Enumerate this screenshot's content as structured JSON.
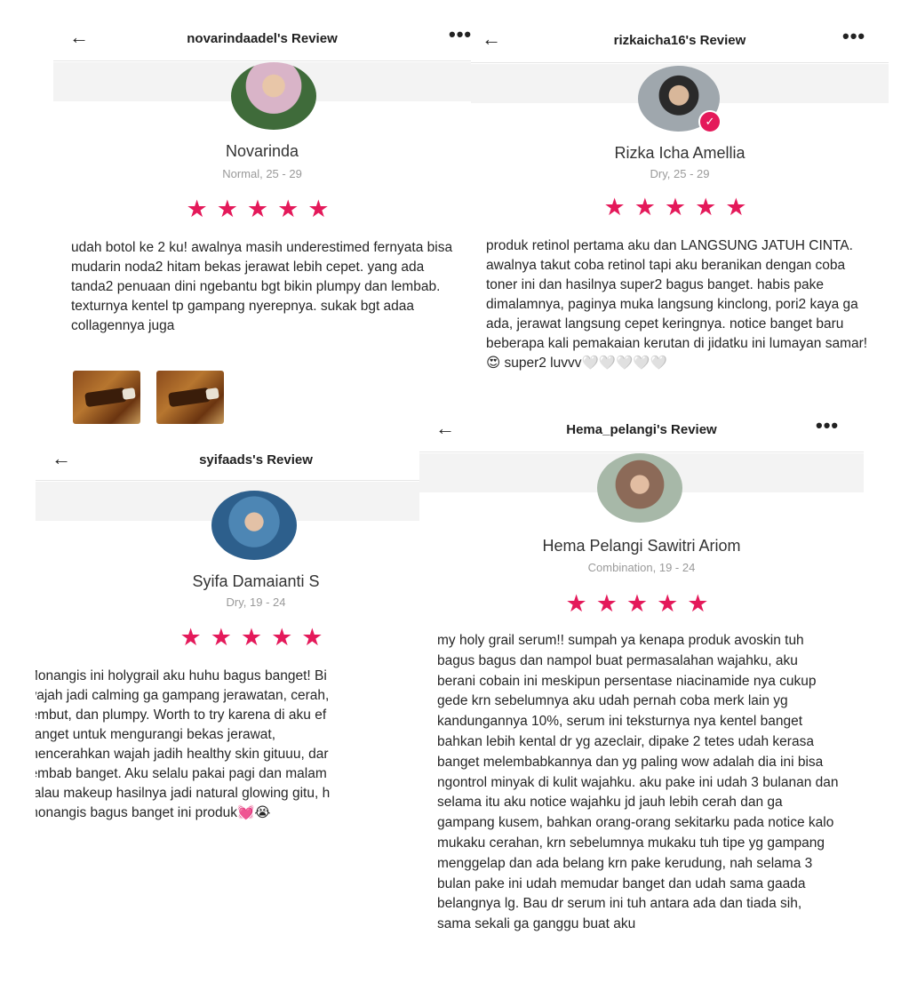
{
  "colors": {
    "star": "#e4195a",
    "accent": "#e4195a"
  },
  "icons": {
    "back": "←",
    "more": "•••",
    "star": "★★★★★",
    "verified": "✓"
  },
  "reviews": [
    {
      "header_title": "novarindaadel's Review",
      "name": "Novarinda",
      "meta": "Normal, 25 - 29",
      "rating": 5,
      "text": "udah botol ke 2 ku! awalnya masih underestimed fernyata bisa mudarin noda2 hitam bekas jerawat lebih cepet. yang ada tanda2 penuaan dini ngebantu bgt bikin plumpy dan lembab. texturnya kentel tp gampang nyerepnya. sukak bgt adaa collagennya juga"
    },
    {
      "header_title": "rizkaicha16's Review",
      "name": "Rizka Icha Amellia",
      "meta": "Dry, 25 - 29",
      "rating": 5,
      "text": "produk retinol pertama aku dan LANGSUNG JATUH CINTA. awalnya takut coba retinol tapi aku beranikan dengan coba toner ini dan hasilnya super2 bagus banget. habis pake dimalamnya, paginya muka langsung kinclong, pori2 kaya ga ada, jerawat langsung cepet keringnya. notice banget baru beberapa kali pemakaian kerutan di jidatku ini lumayan samar! 😍 super2 luvvv🤍🤍🤍🤍🤍"
    },
    {
      "header_title": "syifaads's Review",
      "name": "Syifa Damaianti S",
      "meta": "Dry, 19 - 24",
      "rating": 5,
      "lines": [
        "Monangis ini holygrail aku huhu bagus banget! Bi",
        "wajah jadi calming ga gampang jerawatan, cerah,",
        "lembut, dan plumpy. Worth to try karena di aku ef",
        "banget untuk mengurangi bekas jerawat,",
        "mencerahkan wajah jadih healthy skin gituuu, dar",
        "lembab banget. Aku selalu pakai pagi dan malam",
        "kalau makeup hasilnya jadi natural glowing gitu, h",
        "monangis bagus banget ini produk💓😭"
      ]
    },
    {
      "header_title": "Hema_pelangi's Review",
      "name": "Hema Pelangi Sawitri Ariom",
      "meta": "Combination, 19 - 24",
      "rating": 5,
      "text": "my holy grail serum!! sumpah ya kenapa produk avoskin tuh bagus bagus dan nampol buat permasalahan wajahku, aku berani cobain ini meskipun persentase niacinamide nya cukup gede krn sebelumnya aku udah pernah coba merk lain yg kandungannya 10%, serum ini teksturnya nya kentel banget bahkan lebih kental dr yg azeclair, dipake 2 tetes udah kerasa banget melembabkannya dan yg paling wow adalah dia ini bisa ngontrol minyak di kulit wajahku. aku pake ini udah 3 bulanan dan selama itu aku notice wajahku jd jauh lebih cerah dan ga gampang kusem, bahkan orang-orang sekitarku pada notice kalo mukaku cerahan, krn sebelumnya mukaku tuh tipe yg gampang menggelap dan ada belang krn pake kerudung, nah selama 3 bulan pake ini udah memudar banget dan udah sama gaada belangnya lg. Bau dr serum ini tuh antara ada dan tiada sih, sama sekali ga ganggu buat aku"
    }
  ]
}
